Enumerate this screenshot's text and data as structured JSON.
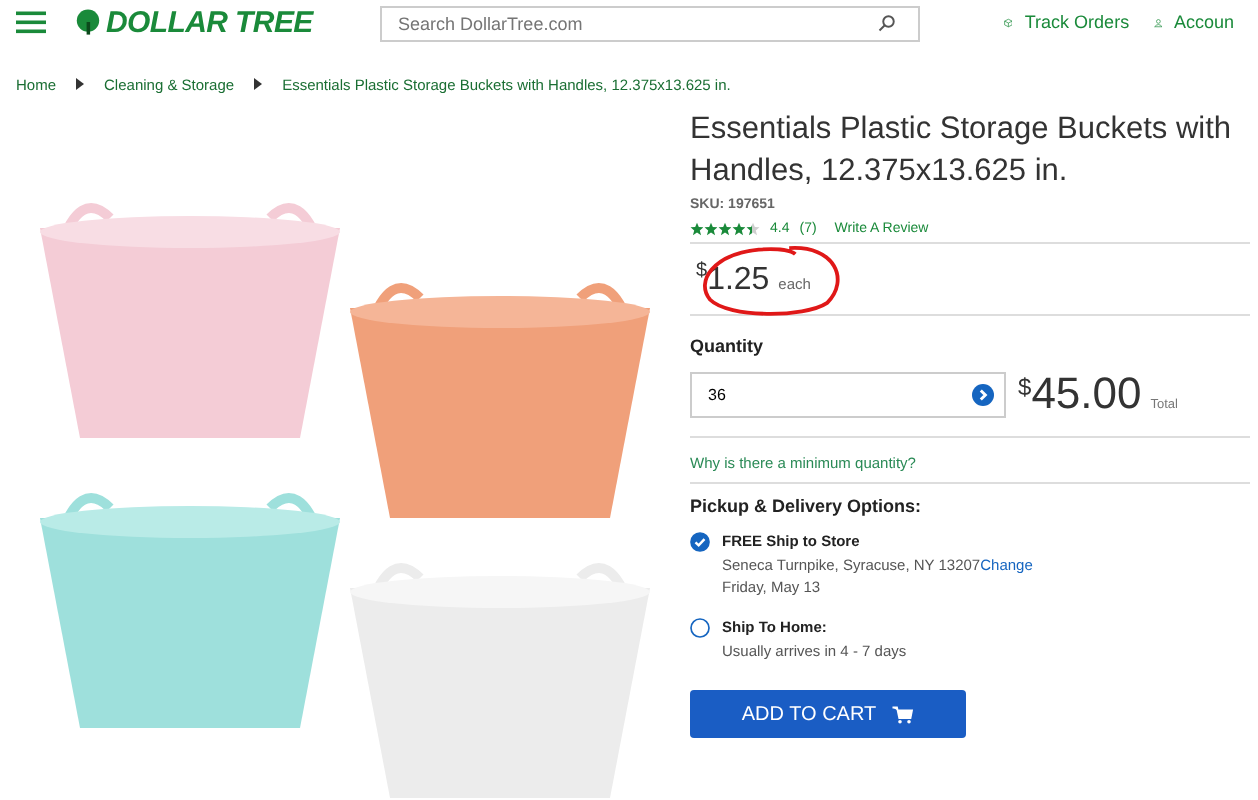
{
  "header": {
    "logo": "DOLLAR TREE",
    "search": {
      "placeholder": "Search DollarTree.com"
    },
    "links": [
      "Track Orders",
      "Accoun"
    ]
  },
  "breadcrumb": [
    "Home",
    "Cleaning & Storage",
    "Essentials Plastic Storage Buckets with Handles, 12.375x13.625 in."
  ],
  "product": {
    "title": "Essentials Plastic Storage Buckets with Handles, 12.375x13.625 in.",
    "sku": "SKU: 197651",
    "stars": 4.4,
    "rating": "4.4",
    "reviews": "(7)",
    "write_review": "Write A Review",
    "price": {
      "currency": "$",
      "amount": "1.25",
      "unit": "each"
    },
    "quantity": {
      "label": "Quantity",
      "value": "36"
    },
    "total": {
      "currency": "$",
      "amount": "45.00",
      "label": "Total"
    },
    "min_link": "Why is there a minimum quantity?",
    "delivery": {
      "title": "Pickup & Delivery Options:",
      "options": [
        {
          "title": "FREE Ship to Store",
          "lines": [
            "Seneca Turnpike, Syracuse, NY 13207",
            "Friday, May 13"
          ],
          "link": "Change",
          "selected": true
        },
        {
          "title": "Ship To Home:",
          "lines": [
            "Usually arrives in 4 - 7 days"
          ],
          "selected": false
        }
      ]
    },
    "add_to_cart": "ADD TO CART"
  }
}
